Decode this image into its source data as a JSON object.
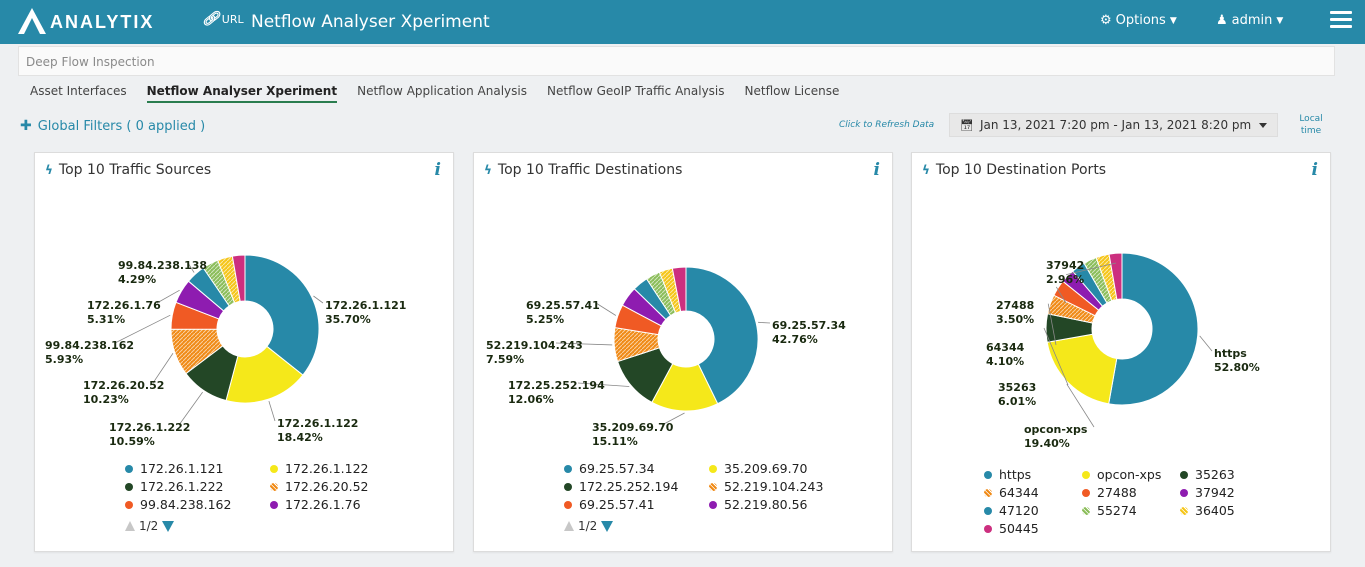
{
  "app": {
    "logo_text": "ANALYTIX",
    "url_label": "URL",
    "title": "Netflow Analyser Xperiment",
    "options_label": "Options",
    "user_label": "admin"
  },
  "breadcrumb": "Deep Flow Inspection",
  "tabs": [
    {
      "label": "Asset Interfaces",
      "active": false
    },
    {
      "label": "Netflow Analyser Xperiment",
      "active": true
    },
    {
      "label": "Netflow Application Analysis",
      "active": false
    },
    {
      "label": "Netflow GeoIP Traffic Analysis",
      "active": false
    },
    {
      "label": "Netflow License",
      "active": false
    }
  ],
  "filters_label": "Global Filters ( 0 applied )",
  "refresh_label": "Click to Refresh Data",
  "date_range": "Jan 13, 2021 7:20 pm - Jan 13, 2021 8:20 pm",
  "local_time_label": "Local time",
  "chart_data": [
    {
      "type": "pie",
      "title": "Top 10 Traffic Sources",
      "series": [
        {
          "name": "172.26.1.121",
          "value": 35.7,
          "color": "#2789a8"
        },
        {
          "name": "172.26.1.122",
          "value": 18.42,
          "color": "#f5e81a"
        },
        {
          "name": "172.26.1.222",
          "value": 10.59,
          "color": "#234726"
        },
        {
          "name": "172.26.20.52",
          "value": 10.23,
          "color": "#f08a16",
          "pattern": true
        },
        {
          "name": "99.84.238.162",
          "value": 5.93,
          "color": "#f05a24"
        },
        {
          "name": "172.26.1.76",
          "value": 5.31,
          "color": "#8e1cb0"
        },
        {
          "name": "",
          "value": 4.29,
          "color": "#2789a8"
        },
        {
          "name": "",
          "value": 3.5,
          "color": "#8bbd5a",
          "pattern": true
        },
        {
          "name": "",
          "value": 3.3,
          "color": "#f5c518",
          "pattern": true
        },
        {
          "name": "",
          "value": 2.73,
          "color": "#cc2f7f"
        }
      ],
      "labels": [
        {
          "name": "172.26.1.121",
          "pct": "35.70%"
        },
        {
          "name": "172.26.1.122",
          "pct": "18.42%"
        },
        {
          "name": "172.26.1.222",
          "pct": "10.59%"
        },
        {
          "name": "172.26.20.52",
          "pct": "10.23%"
        },
        {
          "name": "99.84.238.162",
          "pct": "5.93%"
        },
        {
          "name": "172.26.1.76",
          "pct": "5.31%"
        },
        {
          "name": "99.84.238.138",
          "pct": "4.29%"
        }
      ],
      "legend": [
        {
          "label": "172.26.1.121",
          "color": "#2789a8"
        },
        {
          "label": "172.26.1.122",
          "color": "#f5e81a"
        },
        {
          "label": "172.26.1.222",
          "color": "#234726"
        },
        {
          "label": "172.26.20.52",
          "color": "#f08a16",
          "pattern": true
        },
        {
          "label": "99.84.238.162",
          "color": "#f05a24"
        },
        {
          "label": "172.26.1.76",
          "color": "#8e1cb0"
        }
      ],
      "pager": "1/2"
    },
    {
      "type": "pie",
      "title": "Top 10 Traffic Destinations",
      "series": [
        {
          "name": "69.25.57.34",
          "value": 42.76,
          "color": "#2789a8"
        },
        {
          "name": "35.209.69.70",
          "value": 15.11,
          "color": "#f5e81a"
        },
        {
          "name": "172.25.252.194",
          "value": 12.06,
          "color": "#234726"
        },
        {
          "name": "52.219.104.243",
          "value": 7.59,
          "color": "#f08a16",
          "pattern": true
        },
        {
          "name": "69.25.57.41",
          "value": 5.25,
          "color": "#f05a24"
        },
        {
          "name": "52.219.80.56",
          "value": 4.5,
          "color": "#8e1cb0"
        },
        {
          "name": "",
          "value": 3.5,
          "color": "#2789a8"
        },
        {
          "name": "",
          "value": 3.2,
          "color": "#8bbd5a",
          "pattern": true
        },
        {
          "name": "",
          "value": 3.0,
          "color": "#f5c518",
          "pattern": true
        },
        {
          "name": "",
          "value": 3.03,
          "color": "#cc2f7f"
        }
      ],
      "labels": [
        {
          "name": "69.25.57.34",
          "pct": "42.76%"
        },
        {
          "name": "35.209.69.70",
          "pct": "15.11%"
        },
        {
          "name": "172.25.252.194",
          "pct": "12.06%"
        },
        {
          "name": "52.219.104.243",
          "pct": "7.59%"
        },
        {
          "name": "69.25.57.41",
          "pct": "5.25%"
        }
      ],
      "legend": [
        {
          "label": "69.25.57.34",
          "color": "#2789a8"
        },
        {
          "label": "35.209.69.70",
          "color": "#f5e81a"
        },
        {
          "label": "172.25.252.194",
          "color": "#234726"
        },
        {
          "label": "52.219.104.243",
          "color": "#f08a16",
          "pattern": true
        },
        {
          "label": "69.25.57.41",
          "color": "#f05a24"
        },
        {
          "label": "52.219.80.56",
          "color": "#8e1cb0"
        }
      ],
      "pager": "1/2"
    },
    {
      "type": "pie",
      "title": "Top 10 Destination Ports",
      "series": [
        {
          "name": "https",
          "value": 52.8,
          "color": "#2789a8"
        },
        {
          "name": "opcon-xps",
          "value": 19.4,
          "color": "#f5e81a"
        },
        {
          "name": "35263",
          "value": 6.01,
          "color": "#234726"
        },
        {
          "name": "64344",
          "value": 4.1,
          "color": "#f08a16",
          "pattern": true
        },
        {
          "name": "27488",
          "value": 3.5,
          "color": "#f05a24"
        },
        {
          "name": "37942",
          "value": 2.96,
          "color": "#8e1cb0"
        },
        {
          "name": "47120",
          "value": 2.9,
          "color": "#2789a8"
        },
        {
          "name": "55274",
          "value": 2.8,
          "color": "#8bbd5a",
          "pattern": true
        },
        {
          "name": "36405",
          "value": 2.8,
          "color": "#f5c518",
          "pattern": true
        },
        {
          "name": "50445",
          "value": 2.73,
          "color": "#cc2f7f"
        }
      ],
      "labels": [
        {
          "name": "https",
          "pct": "52.80%"
        },
        {
          "name": "opcon-xps",
          "pct": "19.40%"
        },
        {
          "name": "35263",
          "pct": "6.01%"
        },
        {
          "name": "64344",
          "pct": "4.10%"
        },
        {
          "name": "27488",
          "pct": "3.50%"
        },
        {
          "name": "37942",
          "pct": "2.96%"
        }
      ],
      "legend": [
        {
          "label": "https",
          "color": "#2789a8"
        },
        {
          "label": "opcon-xps",
          "color": "#f5e81a"
        },
        {
          "label": "35263",
          "color": "#234726"
        },
        {
          "label": "64344",
          "color": "#f08a16",
          "pattern": true
        },
        {
          "label": "27488",
          "color": "#f05a24"
        },
        {
          "label": "37942",
          "color": "#8e1cb0"
        },
        {
          "label": "47120",
          "color": "#2789a8"
        },
        {
          "label": "55274",
          "color": "#8bbd5a",
          "pattern": true
        },
        {
          "label": "36405",
          "color": "#f5c518",
          "pattern": true
        },
        {
          "label": "50445",
          "color": "#cc2f7f"
        }
      ],
      "pager": ""
    }
  ]
}
